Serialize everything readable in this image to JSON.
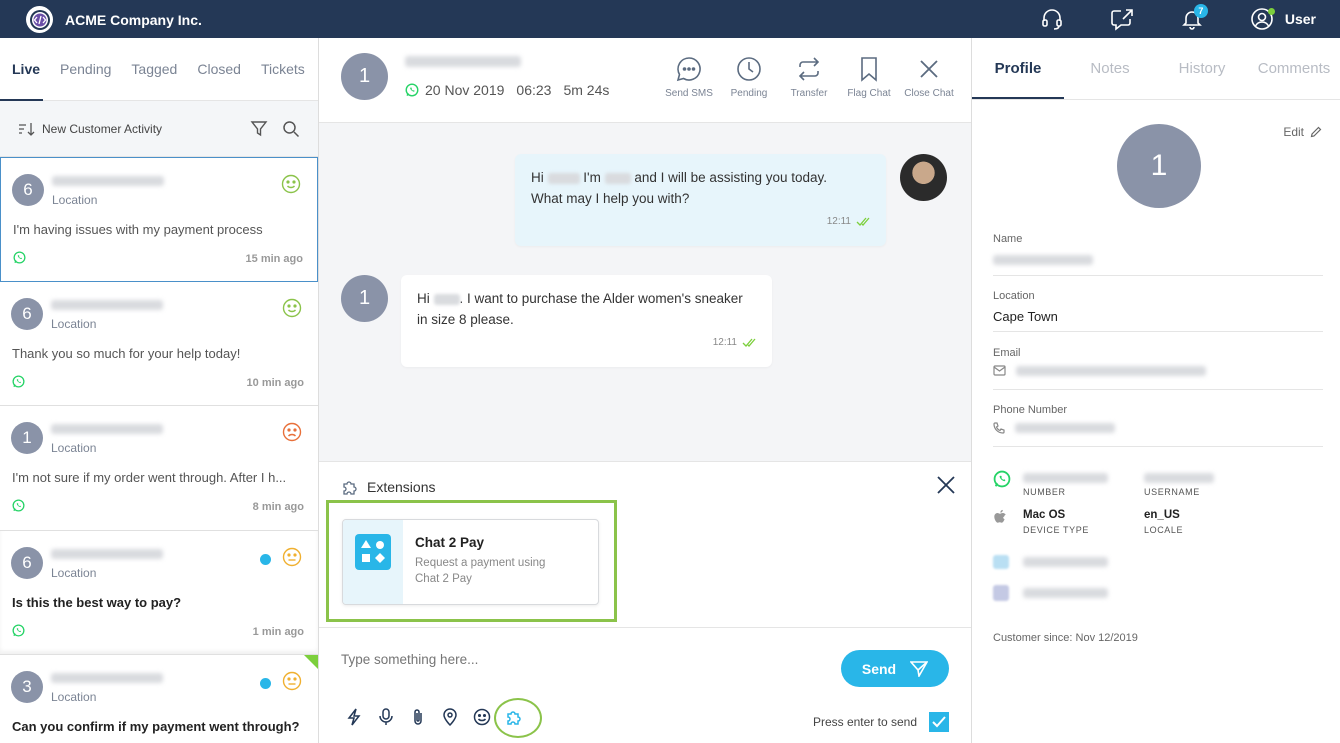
{
  "app": {
    "brand": "ACME Company Inc.",
    "notification_count": "7",
    "user_label": "User"
  },
  "sidebar": {
    "tabs": [
      "Live",
      "Pending",
      "Tagged",
      "Closed",
      "Tickets"
    ],
    "filter_label": "New Customer Activity",
    "conversations": [
      {
        "count": "6",
        "location": "Location",
        "message": "I'm having issues with my payment process",
        "time": "15 min ago",
        "mood": "happy"
      },
      {
        "count": "6",
        "location": "Location",
        "message": "Thank you so much for your help today!",
        "time": "10 min ago",
        "mood": "happy"
      },
      {
        "count": "1",
        "location": "Location",
        "message": "I'm not sure if my order went through. After I h...",
        "time": "8 min ago",
        "mood": "sad"
      },
      {
        "count": "6",
        "location": "Location",
        "message": "Is this the best way to pay?",
        "time": "1 min ago",
        "mood": "neutral"
      },
      {
        "count": "3",
        "location": "Location",
        "message": "Can you confirm if my payment went through?",
        "time": "",
        "mood": "neutral"
      }
    ]
  },
  "chat": {
    "avatar": "1",
    "date": "20 Nov 2019",
    "time": "06:23",
    "duration": "5m 24s",
    "actions": [
      "Send SMS",
      "Pending",
      "Transfer",
      "Flag Chat",
      "Close Chat"
    ],
    "outgoing": {
      "p1": "Hi",
      "p2": "I'm",
      "p3": "and I will be assisting you today.",
      "line2": "What may I help you with?",
      "time": "12:11"
    },
    "incoming": {
      "p1": "Hi",
      "p2": ". I want to purchase the Alder women's sneaker",
      "line2": "in size 8 please.",
      "time": "12:11"
    },
    "incoming_avatar": "1"
  },
  "extensions": {
    "title": "Extensions",
    "card_title": "Chat 2 Pay",
    "card_desc": "Request a payment using Chat 2 Pay"
  },
  "composer": {
    "placeholder": "Type something here...",
    "send_label": "Send",
    "enter_label": "Press enter to send",
    "enter_checked": true
  },
  "profile": {
    "tabs": [
      "Profile",
      "Notes",
      "History",
      "Comments"
    ],
    "edit_label": "Edit",
    "avatar": "1",
    "name_label": "Name",
    "location_label": "Location",
    "location_value": "Cape Town",
    "email_label": "Email",
    "phone_label": "Phone  Number",
    "number_label": "NUMBER",
    "username_label": "USERNAME",
    "device_value": "Mac OS",
    "device_label": "DEVICE TYPE",
    "locale_value": "en_US",
    "locale_label": "LOCALE",
    "since": "Customer since: Nov 12/2019"
  },
  "colors": {
    "topbar": "#243856",
    "accent": "#29b6e8",
    "highlight": "#8bc34a",
    "whatsapp": "#25d366"
  }
}
